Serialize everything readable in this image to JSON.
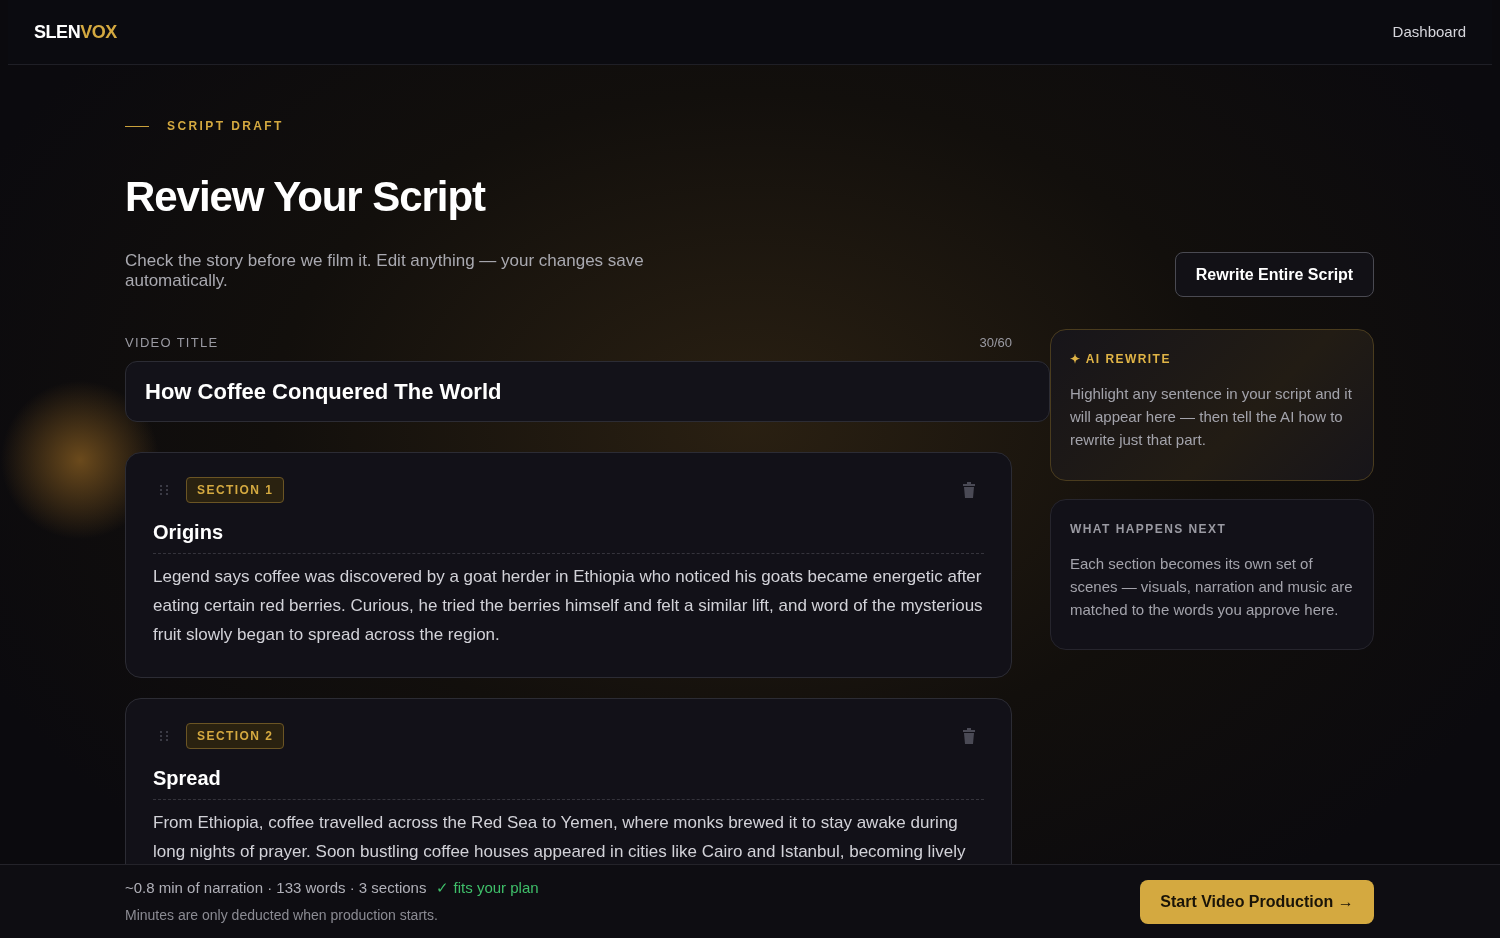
{
  "brand": {
    "part_1": "SLEN",
    "part_2": "VOX"
  },
  "nav": {
    "link": "Dashboard"
  },
  "eyebrow": "SCRIPT DRAFT",
  "heading": "Review Your Script",
  "subtitle": "Check the story before we film it. Edit anything — your changes save automatically.",
  "rewrite_button": "Rewrite Entire Script",
  "video_title": {
    "label": "VIDEO TITLE",
    "counter": "30/60",
    "value": "How Coffee Conquered The World"
  },
  "sections": [
    {
      "badge": "SECTION 1",
      "title": "Origins",
      "body": "Legend says coffee was discovered by a goat herder in Ethiopia who noticed his goats became energetic after eating certain red berries. Curious, he tried the berries himself and felt a similar lift, and word of the mysterious fruit slowly began to spread across the region."
    },
    {
      "badge": "SECTION 2",
      "title": "Spread",
      "body": "From Ethiopia, coffee travelled across the Red Sea to Yemen, where monks brewed it to stay awake during long nights of prayer. Soon bustling coffee houses appeared in cities like Cairo and Istanbul, becoming lively"
    }
  ],
  "side_cards": [
    {
      "kind": "ai",
      "heading": "✦ AI REWRITE",
      "text": "Highlight any sentence in your script and it will appear here — then tell the AI how to rewrite just that part."
    },
    {
      "kind": "info",
      "heading": "WHAT HAPPENS NEXT",
      "text": "Each section becomes its own set of scenes — visuals, narration and music are matched to the words you approve here."
    }
  ],
  "footer": {
    "stats": "~0.8 min of narration · 133 words · 3 sections",
    "plan_status": "✓ fits your plan",
    "note": "Minutes are only deducted when production starts.",
    "button": "Start Video Production →"
  }
}
